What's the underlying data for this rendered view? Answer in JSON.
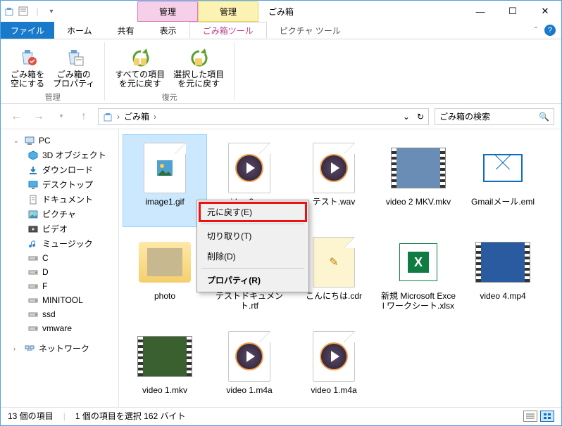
{
  "title": "ごみ箱",
  "context_tabs": [
    {
      "label": "管理",
      "sub": "ごみ箱ツール"
    },
    {
      "label": "管理",
      "sub": "ピクチャ ツール"
    }
  ],
  "file_tab": "ファイル",
  "menu_tabs": [
    "ホーム",
    "共有",
    "表示"
  ],
  "ribbon": {
    "group1": {
      "label": "管理",
      "btn1": "ごみ箱を\n空にする",
      "btn2": "ごみ箱の\nプロパティ"
    },
    "group2": {
      "label": "復元",
      "btn1": "すべての項目\nを元に戻す",
      "btn2": "選択した項目\nを元に戻す"
    }
  },
  "breadcrumb": {
    "root": "ごみ箱",
    "sep": "›"
  },
  "search_placeholder": "ごみ箱の検索",
  "tree": {
    "pc": "PC",
    "children": [
      "3D オブジェクト",
      "ダウンロード",
      "デスクトップ",
      "ドキュメント",
      "ピクチャ",
      "ビデオ",
      "ミュージック",
      "C",
      "D",
      "F",
      "MINITOOL",
      "ssd",
      "vmware"
    ],
    "network": "ネットワーク"
  },
  "items": [
    {
      "name": "image1.gif",
      "kind": "file-gif",
      "selected": true
    },
    {
      "name": "video 2.mpg",
      "kind": "play"
    },
    {
      "name": "テスト.wav",
      "kind": "play"
    },
    {
      "name": "video 2 MKV.mkv",
      "kind": "video",
      "bg": "#6a8db5"
    },
    {
      "name": "Gmailメール.eml",
      "kind": "mail"
    },
    {
      "name": "photo",
      "kind": "folder"
    },
    {
      "name": "テストドキュメント.rtf",
      "kind": "file"
    },
    {
      "name": "こんにちは.cdr",
      "kind": "file-cdr"
    },
    {
      "name": "新規 Microsoft Excel ワークシート.xlsx",
      "kind": "excel"
    },
    {
      "name": "video 4.mp4",
      "kind": "video",
      "bg": "#2a5aa0"
    },
    {
      "name": "video 1.mkv",
      "kind": "video",
      "bg": "#3a6030"
    },
    {
      "name": "video 1.m4a",
      "kind": "play"
    },
    {
      "name": "video 1.m4a",
      "kind": "play"
    }
  ],
  "context_menu": {
    "restore": "元に戻す(E)",
    "cut": "切り取り(T)",
    "delete": "削除(D)",
    "properties": "プロパティ(R)"
  },
  "status": {
    "count": "13 個の項目",
    "selection": "1 個の項目を選択 162 バイト"
  }
}
